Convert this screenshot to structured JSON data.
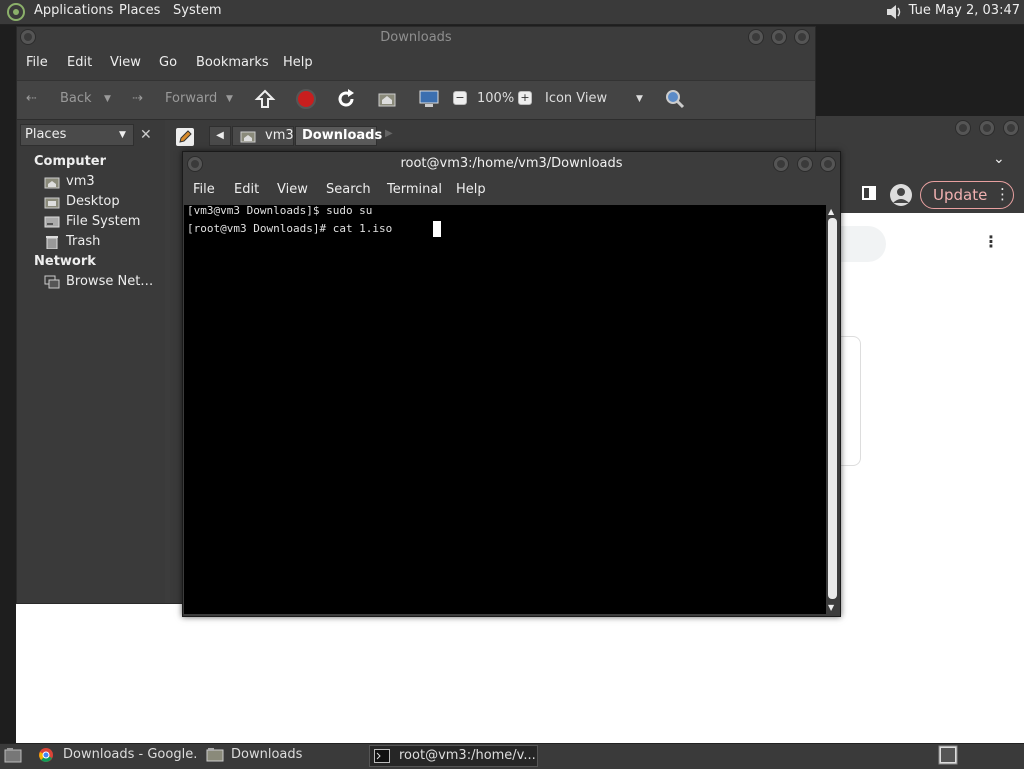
{
  "top_panel": {
    "menus": [
      "Applications",
      "Places",
      "System"
    ],
    "clock": "Tue May  2, 03:47",
    "volume_icon": "speaker-icon"
  },
  "file_manager": {
    "title": "Downloads",
    "menu": [
      "File",
      "Edit",
      "View",
      "Go",
      "Bookmarks",
      "Help"
    ],
    "toolbar": {
      "back": "Back",
      "forward": "Forward",
      "zoom": "100%",
      "view_mode": "Icon View"
    },
    "sidebar": {
      "selector": "Places",
      "sections": [
        {
          "heading": "Computer",
          "items": [
            "vm3",
            "Desktop",
            "File System",
            "Trash"
          ]
        },
        {
          "heading": "Network",
          "items": [
            "Browse Net…"
          ]
        }
      ]
    },
    "path": [
      "vm3",
      "Downloads"
    ]
  },
  "terminal": {
    "title": "root@vm3:/home/vm3/Downloads",
    "menu": [
      "File",
      "Edit",
      "View",
      "Search",
      "Terminal",
      "Help"
    ],
    "lines": [
      "[vm3@vm3 Downloads]$ sudo su",
      "[root@vm3 Downloads]# cat 1.iso"
    ]
  },
  "chrome": {
    "update_label": "Update"
  },
  "taskbar": {
    "items": [
      "Downloads - Google...",
      "Downloads",
      "root@vm3:/home/v..."
    ]
  },
  "colors": {
    "panel": "#3a3a3a",
    "window": "#3c3c3c",
    "terminal_bg": "#000000",
    "update_accent": "#e8a0a0"
  }
}
